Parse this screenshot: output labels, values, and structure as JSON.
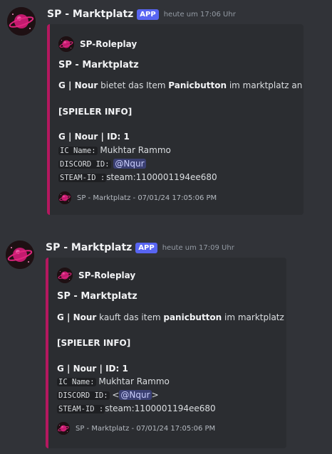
{
  "colors": {
    "background": "#313338",
    "embed_bg": "#2b2d31",
    "embed_border": "#b4185f",
    "badge": "#5865f2"
  },
  "messages": [
    {
      "username": "SP - Marktplatz",
      "badge": "APP",
      "timestamp": "heute um 17:06 Uhr",
      "avatar_icon": "planet-icon",
      "embed": {
        "author": "SP-Roleplay",
        "title": "SP - Marktplatz",
        "line1": {
          "a": "G | Nour",
          "b": " bietet das Item ",
          "c": "Panicbutton",
          "d": " im marktplatz an"
        },
        "section": "[SPIELER INFO]",
        "id_line": "G | Nour | ID: 1",
        "ic_label": "IC Name:",
        "ic_value": " Mukhtar Rammo",
        "discord_label": "DISCORD ID:",
        "discord_prefix": " ",
        "discord_mention": "@Nqur",
        "discord_suffix": "",
        "steam_label": "STEAM-ID :",
        "steam_value": "steam:1100001194ee680",
        "footer": "SP - Marktplatz - 07/01/24 17:05:06 PM"
      }
    },
    {
      "username": "SP - Marktplatz",
      "badge": "APP",
      "timestamp": "heute um 17:09 Uhr",
      "avatar_icon": "planet-icon",
      "embed": {
        "author": "SP-Roleplay",
        "title": "SP - Marktplatz",
        "line1": {
          "a": "G | Nour",
          "b": " kauft das item ",
          "c": "panicbutton",
          "d": " im marktplatz"
        },
        "section": "[SPIELER INFO]",
        "id_line": "G | Nour | ID: 1",
        "ic_label": "IC Name:",
        "ic_value": " Mukhtar Rammo",
        "discord_label": "DISCORD ID:",
        "discord_prefix": " <",
        "discord_mention": "@Nqur",
        "discord_suffix": ">",
        "steam_label": "STEAM-ID :",
        "steam_value": "steam:1100001194ee680",
        "footer": "SP - Marktplatz - 07/01/24 17:05:06 PM"
      }
    }
  ]
}
